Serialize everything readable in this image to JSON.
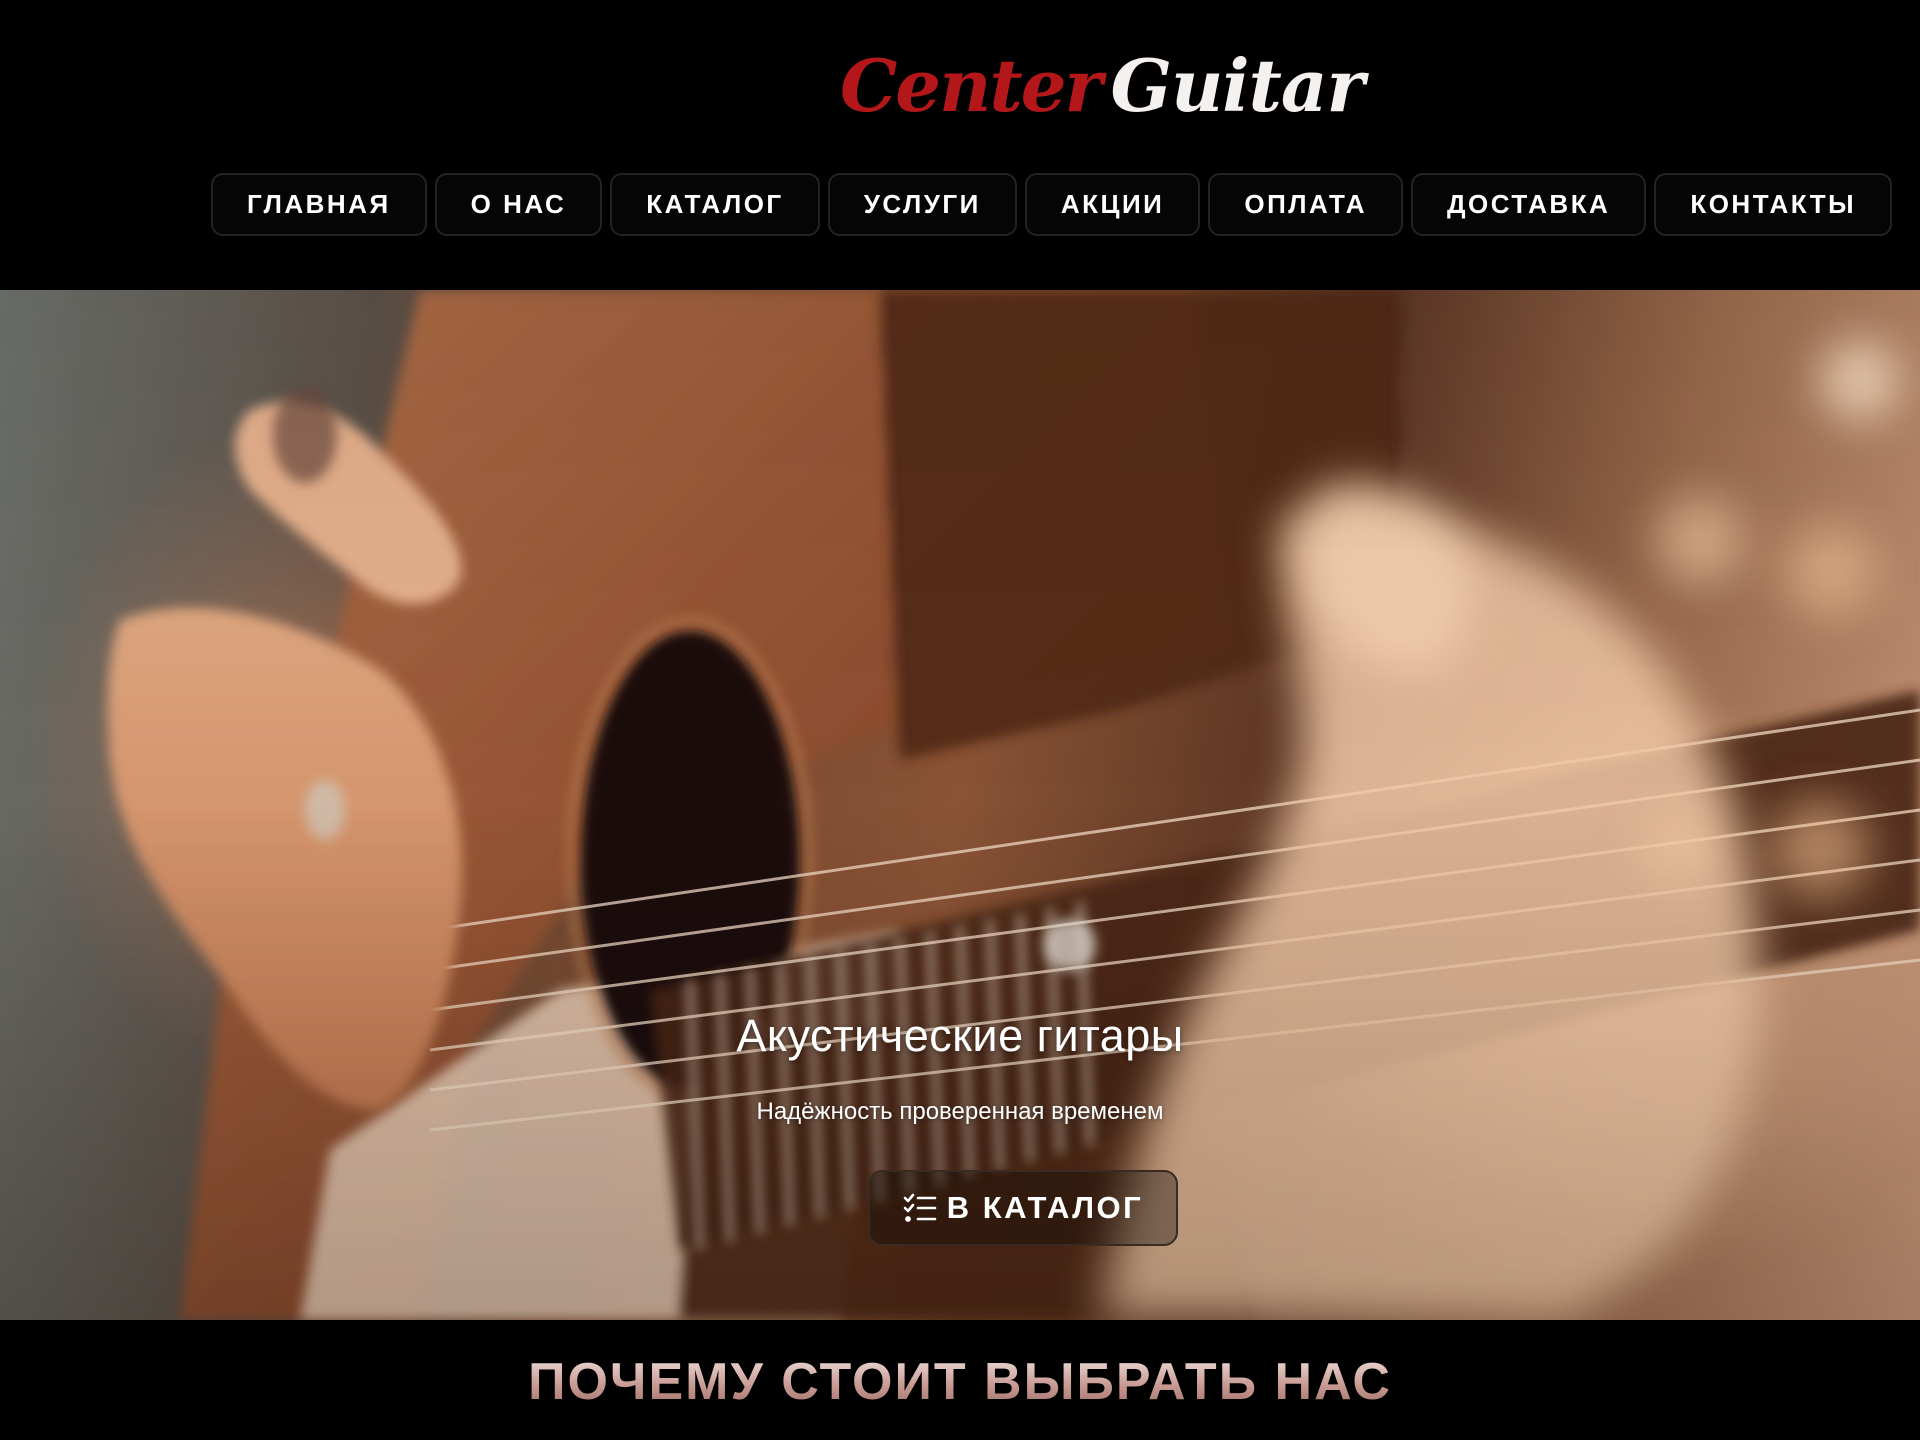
{
  "brand": {
    "logo_part1": "Center",
    "logo_part2": "Guitar",
    "color_part1": "#b3171a",
    "color_part2": "#f4f1ee"
  },
  "nav": {
    "items": [
      {
        "label": "ГЛАВНАЯ"
      },
      {
        "label": "О НАС"
      },
      {
        "label": "КАТАЛОГ"
      },
      {
        "label": "УСЛУГИ"
      },
      {
        "label": "АКЦИИ"
      },
      {
        "label": "ОПЛАТА"
      },
      {
        "label": "ДОСТАВКА"
      },
      {
        "label": "КОНТАКТЫ"
      }
    ]
  },
  "hero": {
    "title": "Акустические гитары",
    "subtitle": "Надёжность проверенная временем",
    "cta_label": "В КАТАЛОГ",
    "cta_icon": "checklist-icon",
    "image": "guitar-photo"
  },
  "why": {
    "title": "ПОЧЕМУ СТОИТ ВЫБРАТЬ НАС"
  },
  "colors": {
    "background": "#000000",
    "text": "#ffffff"
  }
}
